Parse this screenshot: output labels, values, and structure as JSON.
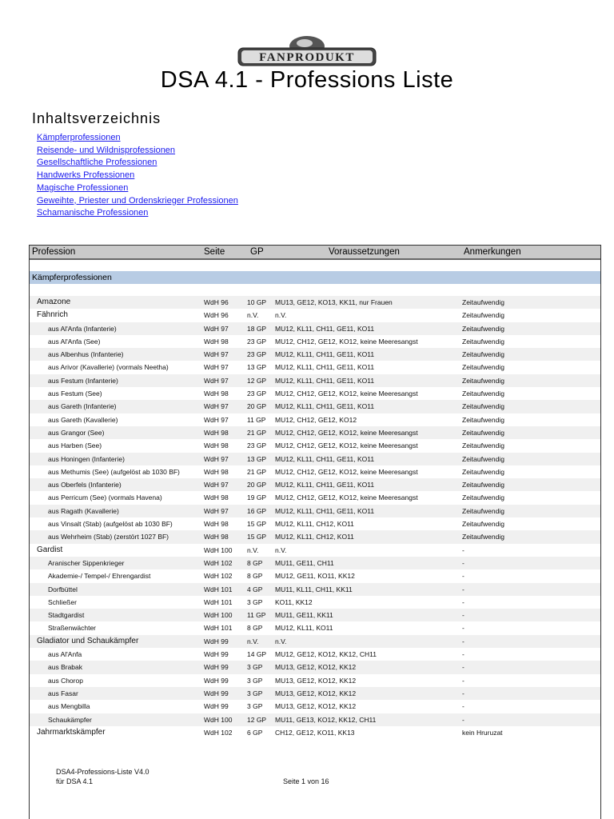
{
  "logo_text": "FANPRODUKT",
  "title": "DSA 4.1 - Professions Liste",
  "toc": {
    "title": "Inhaltsverzeichnis",
    "links": [
      "Kämpferprofessionen",
      "Reisende- und Wildnisprofessionen",
      "Gesellschaftliche Professionen",
      "Handwerks Professionen",
      "Magische Professionen",
      "Geweihte, Priester und Ordenskrieger Professionen",
      "Schamanische Professionen"
    ]
  },
  "table": {
    "headers": [
      "Profession",
      "Seite",
      "GP",
      "Voraussetzungen",
      "Anmerkungen"
    ],
    "section": "Kämpferprofessionen",
    "rows": [
      {
        "level": "top",
        "c": [
          "Amazone",
          "WdH 96",
          "10 GP",
          "MU13, GE12, KO13, KK11, nur Frauen",
          "Zeitaufwendig"
        ]
      },
      {
        "level": "top",
        "c": [
          "Fähnrich",
          "WdH 96",
          "n.V.",
          "n.V.",
          "Zeitaufwendig"
        ]
      },
      {
        "level": "sub",
        "c": [
          "aus Al'Anfa (Infanterie)",
          "WdH 97",
          "18 GP",
          "MU12, KL11, CH11, GE11, KO11",
          "Zeitaufwendig"
        ]
      },
      {
        "level": "sub",
        "c": [
          "aus Al'Anfa (See)",
          "WdH 98",
          "23 GP",
          "MU12, CH12, GE12, KO12, keine Meeresangst",
          "Zeitaufwendig"
        ]
      },
      {
        "level": "sub",
        "c": [
          "aus Albenhus (Infanterie)",
          "WdH 97",
          "23 GP",
          "MU12, KL11, CH11, GE11, KO11",
          "Zeitaufwendig"
        ]
      },
      {
        "level": "sub",
        "c": [
          "aus Arivor (Kavallerie) (vormals Neetha)",
          "WdH 97",
          "13 GP",
          "MU12, KL11, CH11, GE11, KO11",
          "Zeitaufwendig"
        ]
      },
      {
        "level": "sub",
        "c": [
          "aus Festum (Infanterie)",
          "WdH 97",
          "12 GP",
          "MU12, KL11, CH11, GE11, KO11",
          "Zeitaufwendig"
        ]
      },
      {
        "level": "sub",
        "c": [
          "aus Festum (See)",
          "WdH 98",
          "23 GP",
          "MU12, CH12, GE12, KO12, keine Meeresangst",
          "Zeitaufwendig"
        ]
      },
      {
        "level": "sub",
        "c": [
          "aus Gareth (Infanterie)",
          "WdH 97",
          "20 GP",
          "MU12, KL11, CH11, GE11, KO11",
          "Zeitaufwendig"
        ]
      },
      {
        "level": "sub",
        "c": [
          "aus Gareth (Kavallerie)",
          "WdH 97",
          "11 GP",
          "MU12, CH12, GE12, KO12",
          "Zeitaufwendig"
        ]
      },
      {
        "level": "sub",
        "c": [
          "aus Grangor (See)",
          "WdH 98",
          "21 GP",
          "MU12, CH12, GE12, KO12, keine Meeresangst",
          "Zeitaufwendig"
        ]
      },
      {
        "level": "sub",
        "c": [
          "aus Harben (See)",
          "WdH 98",
          "23 GP",
          "MU12, CH12, GE12, KO12, keine Meeresangst",
          "Zeitaufwendig"
        ]
      },
      {
        "level": "sub",
        "c": [
          "aus Honingen (Infanterie)",
          "WdH 97",
          "13 GP",
          "MU12, KL11, CH11, GE11, KO11",
          "Zeitaufwendig"
        ]
      },
      {
        "level": "sub",
        "c": [
          "aus Methumis (See) (aufgelöst ab 1030 BF)",
          "WdH 98",
          "21 GP",
          "MU12, CH12, GE12, KO12, keine Meeresangst",
          "Zeitaufwendig"
        ]
      },
      {
        "level": "sub",
        "c": [
          "aus Oberfels (Infanterie)",
          "WdH 97",
          "20 GP",
          "MU12, KL11, CH11, GE11, KO11",
          "Zeitaufwendig"
        ]
      },
      {
        "level": "sub",
        "c": [
          "aus Perricum (See) (vormals Havena)",
          "WdH 98",
          "19 GP",
          "MU12, CH12, GE12, KO12, keine Meeresangst",
          "Zeitaufwendig"
        ]
      },
      {
        "level": "sub",
        "c": [
          "aus Ragath (Kavallerie)",
          "WdH 97",
          "16 GP",
          "MU12, KL11, CH11, GE11, KO11",
          "Zeitaufwendig"
        ]
      },
      {
        "level": "sub",
        "c": [
          "aus Vinsalt (Stab) (aufgelöst ab 1030 BF)",
          "WdH 98",
          "15 GP",
          "MU12, KL11, CH12, KO11",
          "Zeitaufwendig"
        ]
      },
      {
        "level": "sub",
        "c": [
          "aus Wehrheim (Stab) (zerstört 1027 BF)",
          "WdH 98",
          "15 GP",
          "MU12, KL11, CH12, KO11",
          "Zeitaufwendig"
        ]
      },
      {
        "level": "top",
        "c": [
          "Gardist",
          "WdH 100",
          "n.V.",
          "n.V.",
          "-"
        ]
      },
      {
        "level": "sub",
        "c": [
          "Aranischer Sippenkrieger",
          "WdH 102",
          "8 GP",
          "MU11, GE11, CH11",
          "-"
        ]
      },
      {
        "level": "sub",
        "c": [
          "Akademie-/ Tempel-/ Ehrengardist",
          "WdH 102",
          "8 GP",
          "MU12, GE11, KO11, KK12",
          "-"
        ]
      },
      {
        "level": "sub",
        "c": [
          "Dorfbüttel",
          "WdH 101",
          "4 GP",
          "MU11, KL11, CH11, KK11",
          "-"
        ]
      },
      {
        "level": "sub",
        "c": [
          "Schließer",
          "WdH 101",
          "3 GP",
          "KO11, KK12",
          "-"
        ]
      },
      {
        "level": "sub",
        "c": [
          "Stadtgardist",
          "WdH 100",
          "11 GP",
          "MU11, GE11, KK11",
          "-"
        ]
      },
      {
        "level": "sub",
        "c": [
          "Straßenwächter",
          "WdH 101",
          "8 GP",
          "MU12, KL11, KO11",
          "-"
        ]
      },
      {
        "level": "top",
        "c": [
          "Gladiator und Schaukämpfer",
          "WdH 99",
          "n.V.",
          "n.V.",
          "-"
        ]
      },
      {
        "level": "sub",
        "c": [
          "aus Al'Anfa",
          "WdH 99",
          "14 GP",
          "MU12, GE12, KO12, KK12, CH11",
          "-"
        ]
      },
      {
        "level": "sub",
        "c": [
          "aus Brabak",
          "WdH 99",
          "3 GP",
          "MU13, GE12, KO12, KK12",
          "-"
        ]
      },
      {
        "level": "sub",
        "c": [
          "aus Chorop",
          "WdH 99",
          "3 GP",
          "MU13, GE12, KO12, KK12",
          "-"
        ]
      },
      {
        "level": "sub",
        "c": [
          "aus Fasar",
          "WdH 99",
          "3 GP",
          "MU13, GE12, KO12, KK12",
          "-"
        ]
      },
      {
        "level": "sub",
        "c": [
          "aus Mengbilla",
          "WdH 99",
          "3 GP",
          "MU13, GE12, KO12, KK12",
          "-"
        ]
      },
      {
        "level": "sub",
        "c": [
          "Schaukämpfer",
          "WdH 100",
          "12 GP",
          "MU11, GE13, KO12, KK12, CH11",
          "-"
        ]
      },
      {
        "level": "top",
        "c": [
          "Jahrmarktskämpfer",
          "WdH 102",
          "6 GP",
          "CH12, GE12, KO11, KK13",
          "kein Hruruzat"
        ]
      }
    ]
  },
  "footer": {
    "doc": "DSA4-Professions-Liste V4.0",
    "version": "für DSA 4.1",
    "page": "Seite 1 von 16"
  }
}
